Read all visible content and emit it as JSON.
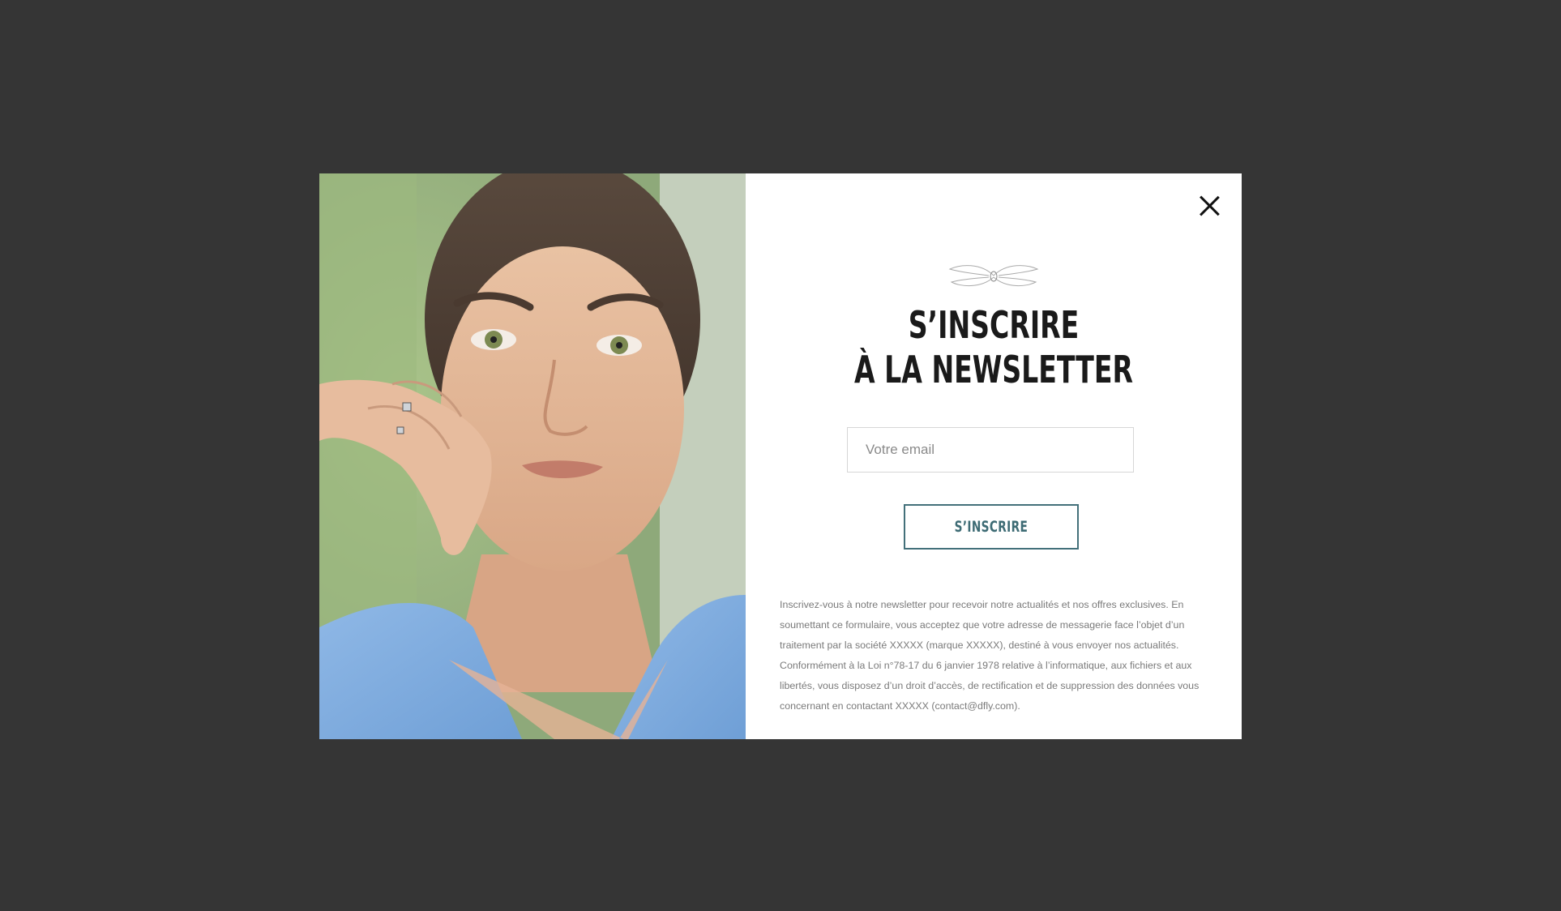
{
  "modal": {
    "photo_alt": "woman-portrait-photo",
    "close_icon": "close-icon",
    "logo_icon": "dragonfly-logo-icon",
    "title_line1": "S’INSCRIRE",
    "title_line2": "À LA NEWSLETTER",
    "email_placeholder": "Votre email",
    "email_value": "",
    "submit_label": "S’INSCRIRE",
    "legal_text": "Inscrivez-vous à notre newsletter pour recevoir notre actualités et nos offres exclusives. En soumettant ce formulaire, vous acceptez que votre adresse de messagerie face l’objet d’un traitement par la société XXXXX (marque XXXXX), destiné à vous envoyer nos actualités. Conformément à la Loi n°78-17 du 6 janvier 1978 relative à l’informatique, aux fichiers et aux libertés, vous disposez d’un droit d’accès, de rectification et de suppression des données vous concernant en contactant XXXXX (contact@dfly.com)."
  },
  "colors": {
    "backdrop": "#353535",
    "accent": "#43707a",
    "title": "#1a1a1a",
    "legal": "#7a7a7a"
  }
}
